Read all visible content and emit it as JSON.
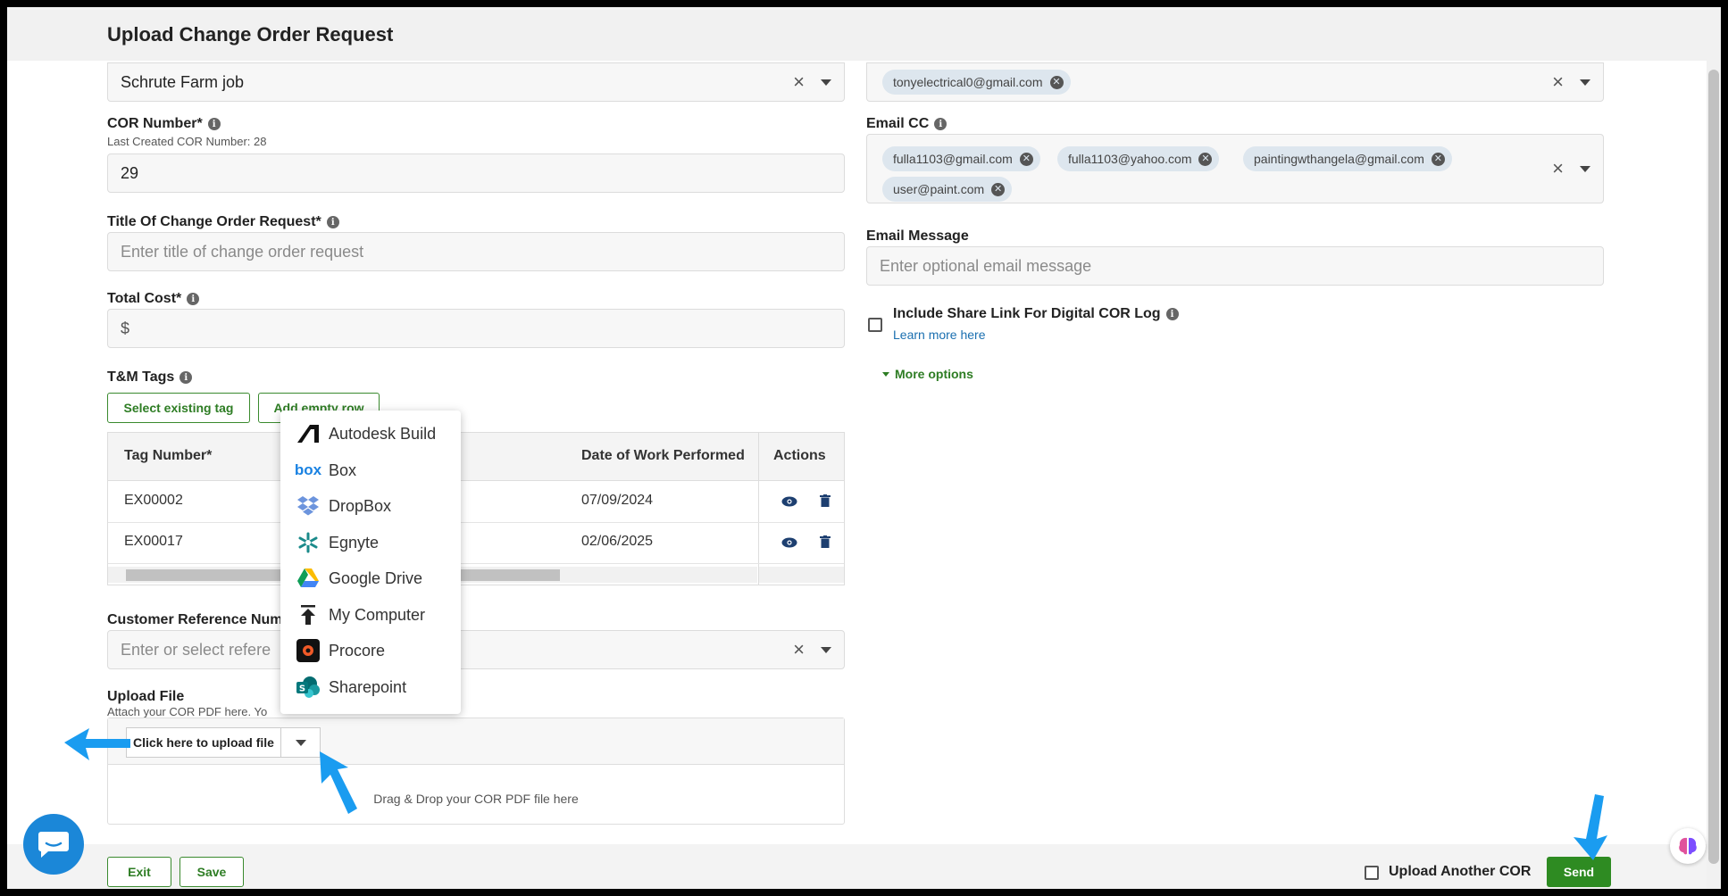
{
  "window": {
    "title": "Upload Change Order Request"
  },
  "left": {
    "project": {
      "value": "Schrute Farm job"
    },
    "cor_number": {
      "label": "COR Number*",
      "sublabel": "Last Created COR Number: 28",
      "value": "29"
    },
    "title_field": {
      "label": "Title Of Change Order Request*",
      "placeholder": "Enter title of change order request"
    },
    "total_cost": {
      "label": "Total Cost*",
      "value": "$"
    },
    "tm_tags": {
      "label": "T&M Tags",
      "select_existing": "Select existing tag",
      "add_empty_row": "Add empty row",
      "columns": {
        "tag": "Tag Number*",
        "date": "Date of Work Performed",
        "actions": "Actions"
      },
      "rows": [
        {
          "tag": "EX00002",
          "date": "07/09/2024"
        },
        {
          "tag": "EX00017",
          "date": "02/06/2025"
        }
      ]
    },
    "customer_ref": {
      "label": "Customer Reference Numb",
      "placeholder": "Enter or select refere"
    },
    "upload": {
      "label": "Upload File",
      "sublabel": "Attach your COR PDF here. Yo",
      "button": "Click here to upload file",
      "drop_text": "Drag & Drop your COR PDF file here"
    }
  },
  "dropdown": {
    "items": [
      {
        "label": "Autodesk Build",
        "icon": "autodesk-icon"
      },
      {
        "label": "Box",
        "icon": "box-icon"
      },
      {
        "label": "DropBox",
        "icon": "dropbox-icon"
      },
      {
        "label": "Egnyte",
        "icon": "egnyte-icon"
      },
      {
        "label": "Google Drive",
        "icon": "google-drive-icon"
      },
      {
        "label": "My Computer",
        "icon": "upload-arrow-icon"
      },
      {
        "label": "Procore",
        "icon": "procore-icon"
      },
      {
        "label": "Sharepoint",
        "icon": "sharepoint-icon"
      }
    ]
  },
  "right": {
    "email_to": {
      "chips": [
        "tonyelectrical0@gmail.com"
      ]
    },
    "email_cc": {
      "label": "Email CC",
      "chips": [
        "fulla1103@gmail.com",
        "fulla1103@yahoo.com",
        "paintingwthangela@gmail.com",
        "user@paint.com"
      ]
    },
    "email_message": {
      "label": "Email Message",
      "placeholder": "Enter optional email message"
    },
    "share_link": {
      "label": "Include Share Link For Digital COR Log",
      "learn_more": "Learn more here"
    },
    "more_options": "More options"
  },
  "footer": {
    "exit": "Exit",
    "save": "Save",
    "upload_another": "Upload Another COR",
    "send": "Send"
  },
  "colors": {
    "accent_green": "#2e8b22",
    "chip_bg": "#dde6ee",
    "annotation_blue": "#1a9cf0"
  }
}
